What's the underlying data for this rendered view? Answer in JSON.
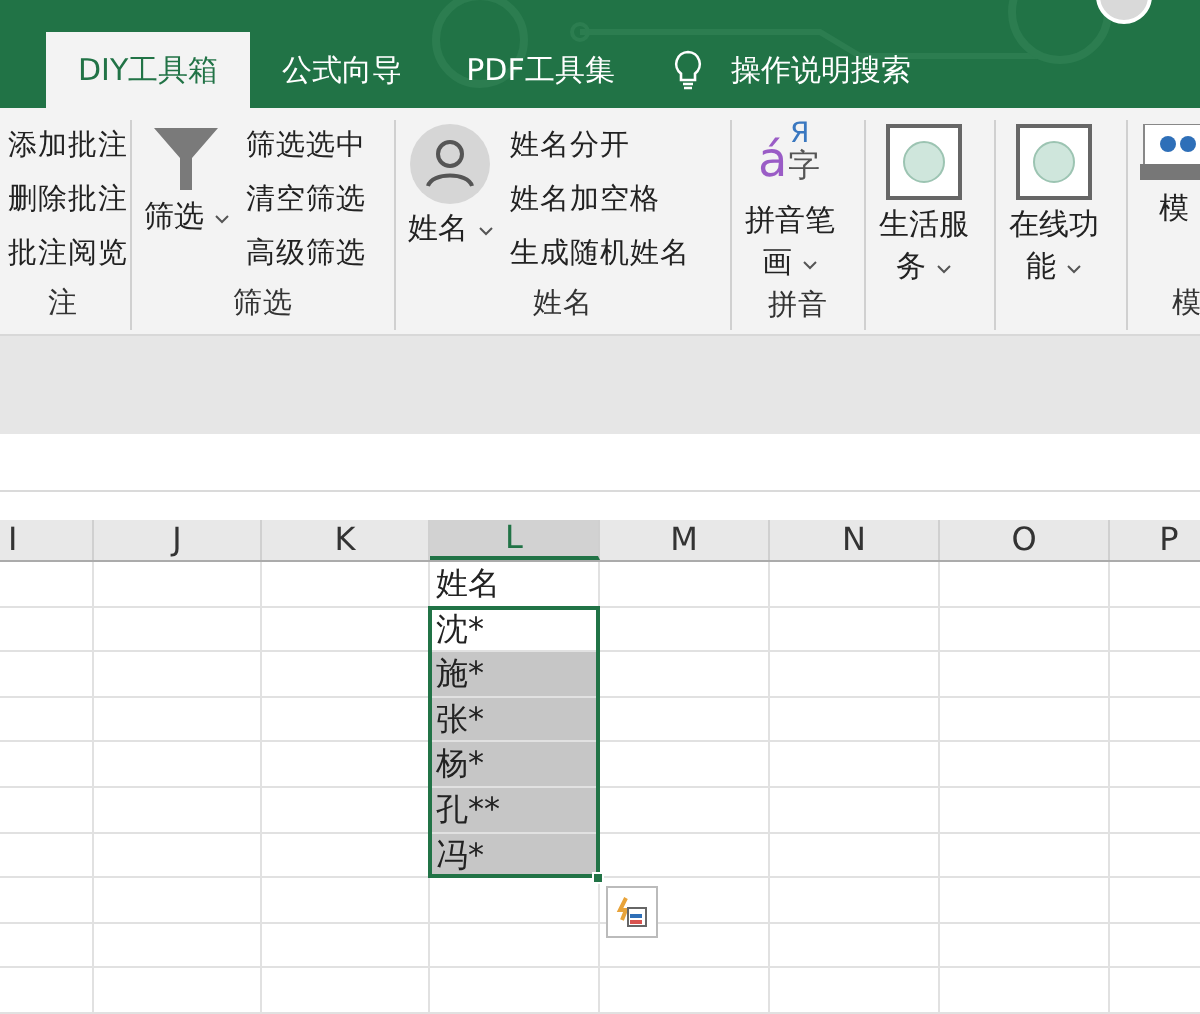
{
  "tabs": [
    {
      "label": "DIY工具箱",
      "selected": true
    },
    {
      "label": "公式向导",
      "selected": false
    },
    {
      "label": "PDF工具集",
      "selected": false
    }
  ],
  "search": {
    "label": "操作说明搜索"
  },
  "ribbon": {
    "groups": [
      {
        "label": "注",
        "buttons": [
          "添加批注",
          "删除批注",
          "批注阅览"
        ]
      },
      {
        "label": "筛选",
        "big": {
          "label": "筛选",
          "kind": "funnel",
          "dropdown": true
        },
        "buttons": [
          "筛选选中",
          "清空筛选",
          "高级筛选"
        ]
      },
      {
        "label": "姓名",
        "big": {
          "label": "姓名",
          "kind": "person",
          "dropdown": true
        },
        "buttons": [
          "姓名分开",
          "姓名加空格",
          "生成随机姓名"
        ]
      },
      {
        "label": "拼音",
        "big": {
          "label": "拼音笔画",
          "kind": "pinyin",
          "glyphs": [
            "á",
            "Я",
            "字"
          ],
          "dropdown": true
        }
      },
      {
        "big": {
          "label": "生活服务",
          "kind": "frame",
          "dropdown": true
        }
      },
      {
        "big": {
          "label": "在线功能",
          "kind": "frame",
          "dropdown": true
        }
      },
      {
        "label": "模",
        "big": {
          "label": "模",
          "kind": "board",
          "dropdown": false
        }
      }
    ]
  },
  "sheet": {
    "columns": [
      {
        "label": "I",
        "selected": false
      },
      {
        "label": "J",
        "selected": false
      },
      {
        "label": "K",
        "selected": false
      },
      {
        "label": "L",
        "selected": true
      },
      {
        "label": "M",
        "selected": false
      },
      {
        "label": "N",
        "selected": false
      },
      {
        "label": "O",
        "selected": false
      },
      {
        "label": "P",
        "selected": false
      }
    ],
    "column_l_cells": [
      {
        "text": "姓名",
        "selected": false
      },
      {
        "text": "沈*",
        "selected": true
      },
      {
        "text": "施*",
        "selected": true
      },
      {
        "text": "张*",
        "selected": true
      },
      {
        "text": "杨*",
        "selected": true
      },
      {
        "text": "孔**",
        "selected": true
      },
      {
        "text": "冯*",
        "selected": true
      }
    ]
  }
}
